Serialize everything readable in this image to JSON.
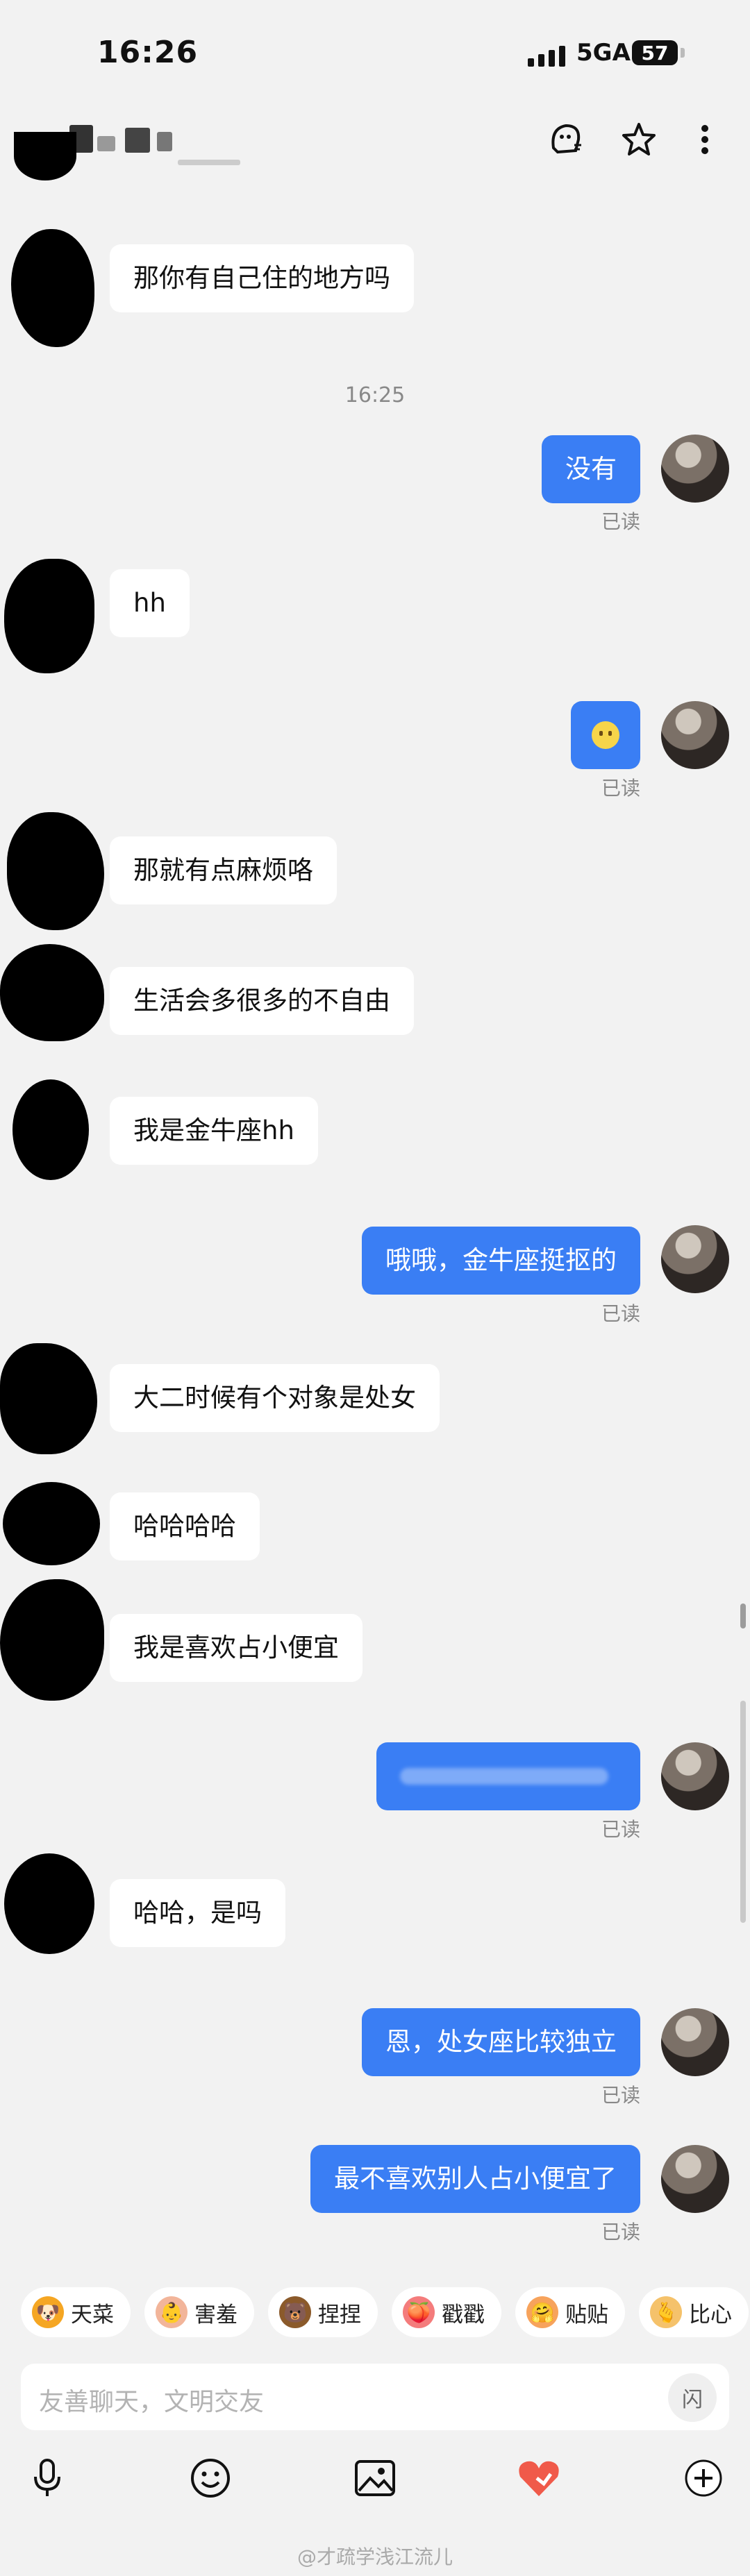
{
  "status": {
    "time": "16:26",
    "network": "5GA",
    "battery": "57"
  },
  "header": {
    "contact_name": "",
    "actions": [
      "ai-assistant-icon",
      "star-icon",
      "more-icon"
    ]
  },
  "messages": [
    {
      "side": "in",
      "text": "那你有自己住的地方吗"
    },
    {
      "side": "timestamp",
      "text": "16:25"
    },
    {
      "side": "out",
      "text": "没有",
      "status": "已读"
    },
    {
      "side": "in",
      "text": "hh"
    },
    {
      "side": "out",
      "text": "😶",
      "status": "已读"
    },
    {
      "side": "in",
      "text": "那就有点麻烦咯"
    },
    {
      "side": "in",
      "text": "生活会多很多的不自由"
    },
    {
      "side": "in",
      "text": "我是金牛座hh"
    },
    {
      "side": "out",
      "text": "哦哦，金牛座挺抠的",
      "status": "已读"
    },
    {
      "side": "in",
      "text": "大二时候有个对象是处女"
    },
    {
      "side": "in",
      "text": "哈哈哈哈"
    },
    {
      "side": "in",
      "text": "我是喜欢占小便宜"
    },
    {
      "side": "out",
      "text": "",
      "status": "已读"
    },
    {
      "side": "in",
      "text": "哈哈，是吗"
    },
    {
      "side": "out",
      "text": "恩，处女座比较独立",
      "status": "已读"
    },
    {
      "side": "out",
      "text": "最不喜欢别人占小便宜了",
      "status": "已读"
    }
  ],
  "quick_replies": [
    {
      "label": "天菜",
      "icon": "dog-face-icon",
      "color": "#f5a623"
    },
    {
      "label": "害羞",
      "icon": "shy-baby-icon",
      "color": "#f2b59a"
    },
    {
      "label": "捏捏",
      "icon": "bear-icon",
      "color": "#8b5a2b"
    },
    {
      "label": "戳戳",
      "icon": "peach-icon",
      "color": "#f47c7c"
    },
    {
      "label": "贴贴",
      "icon": "hug-icon",
      "color": "#f7a35c"
    },
    {
      "label": "比心",
      "icon": "finger-heart-icon",
      "color": "#f5c26b"
    }
  ],
  "input": {
    "placeholder": "友善聊天，文明交友",
    "flash_label": "闪"
  },
  "toolbar": [
    "microphone-icon",
    "emoji-icon",
    "image-icon",
    "heart-gift-icon",
    "plus-icon"
  ],
  "watermark": "@才疏学浅江流儿",
  "colors": {
    "accent": "#3a7ef4",
    "bubble_in": "#ffffff",
    "background": "#f2f2f2"
  }
}
